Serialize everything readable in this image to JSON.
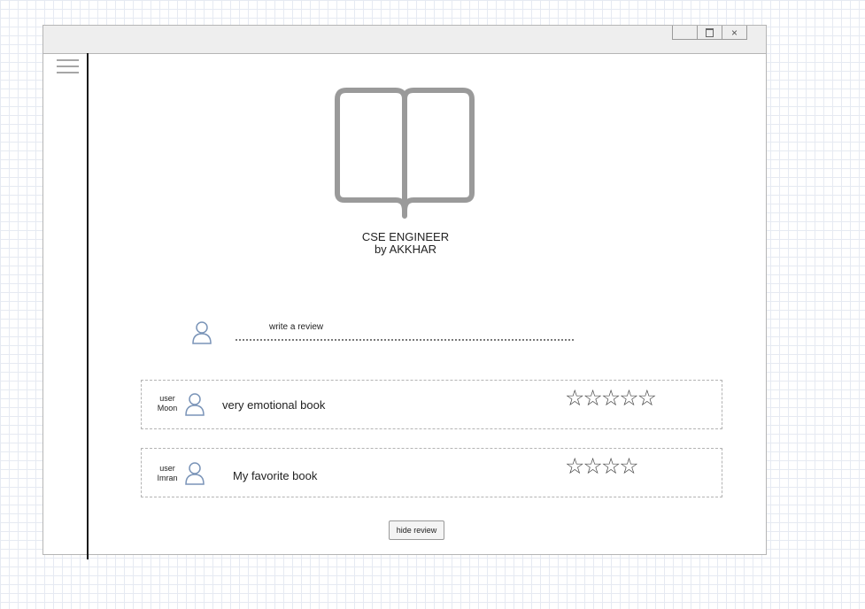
{
  "window": {
    "controls": {
      "minimize": "",
      "close": "×"
    }
  },
  "book": {
    "title": "CSE ENGINEER",
    "author": "by AKKHAR"
  },
  "review_input": {
    "label": "write a review"
  },
  "reviews": [
    {
      "user_prefix": "user",
      "user_name": "Moon",
      "text": "very emotional book",
      "stars": "☆☆☆☆☆"
    },
    {
      "user_prefix": "user",
      "user_name": "Imran",
      "text": "My favorite book",
      "stars": "☆☆☆☆"
    }
  ],
  "hide_button": {
    "label": "hide review"
  }
}
